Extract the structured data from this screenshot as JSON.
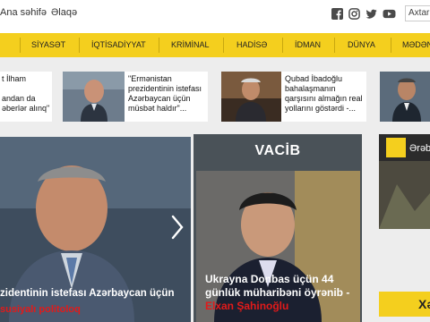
{
  "header": {
    "home_link": "Ana səhifə",
    "contact_link": "Əlaqə",
    "search_placeholder": "Axtar"
  },
  "social": [
    "facebook-icon",
    "instagram-icon",
    "twitter-icon",
    "youtube-icon"
  ],
  "nav": {
    "items": [
      "SİYASƏT",
      "İQTİSADİYYAT",
      "KRİMİNAL",
      "HADİSƏ",
      "İDMAN",
      "DÜNYA",
      "MƏDƏN"
    ]
  },
  "news": [
    {
      "text": "t İlham\n\nandan da\nəberlər alınq\""
    },
    {
      "text": "\"Ermənistan\nprezidentinin istefası\nAzərbaycan üçün\nmüsbət haldır\"..."
    },
    {
      "text": "Qubad İbadoğlu\nbahalaşmanın\nqarşısını almağın real\nyollarını göstərdi -..."
    }
  ],
  "hero": {
    "caption": "zidentinin istefası Azərbaycan üçün",
    "subcaption": "susiyalı politoloq"
  },
  "vacib": {
    "title": "VACİB",
    "caption": "Ukrayna Donbas üçün 44 günlük müharibəni öyrənib -",
    "subcaption": "Elxan Şahinoğlu"
  },
  "side": {
    "label": "Ərəb",
    "button": "Xə"
  },
  "colors": {
    "accent": "#f4cf1e",
    "alert": "#e21a1a",
    "vacib_bg": "#4a5258"
  }
}
